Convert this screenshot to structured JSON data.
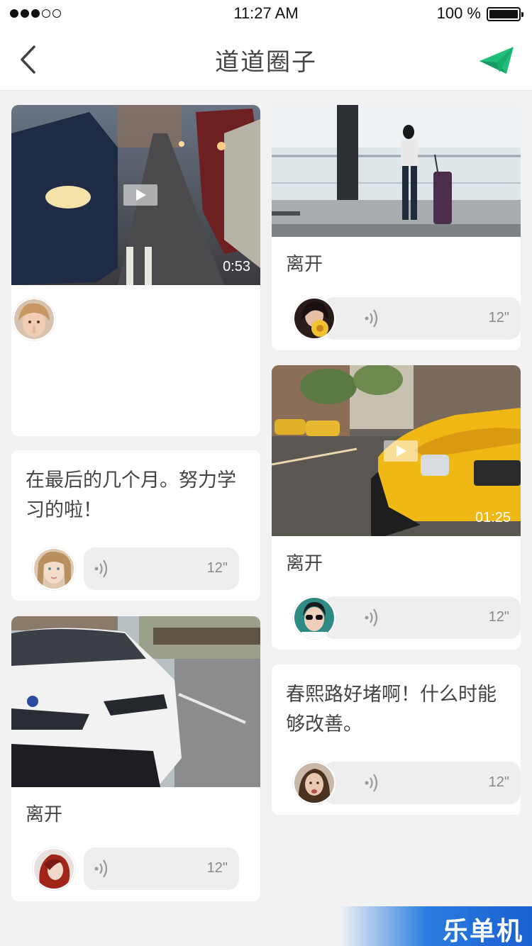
{
  "status": {
    "time": "11:27 AM",
    "battery": "100 %"
  },
  "nav": {
    "title": "道道圈子",
    "back_icon": "chevron-left-icon",
    "send_icon": "paper-plane-icon",
    "accent": "#1fbf7a"
  },
  "posts": [
    {
      "id": "p1",
      "type": "video",
      "duration": "0:53"
    },
    {
      "id": "p2",
      "type": "photo",
      "caption": "离开",
      "voice": "12\""
    },
    {
      "id": "p3",
      "type": "text",
      "text": "在最后的几个月。努力学习的啦！",
      "voice": "12\""
    },
    {
      "id": "p4",
      "type": "video",
      "duration": "01:25",
      "caption": "离开",
      "voice": "12\""
    },
    {
      "id": "p5",
      "type": "photo",
      "caption": "离开",
      "voice": "12\""
    },
    {
      "id": "p6",
      "type": "text",
      "text": "春熙路好堵啊！什么时能够改善。",
      "voice": "12\""
    }
  ],
  "watermark": "乐单机"
}
